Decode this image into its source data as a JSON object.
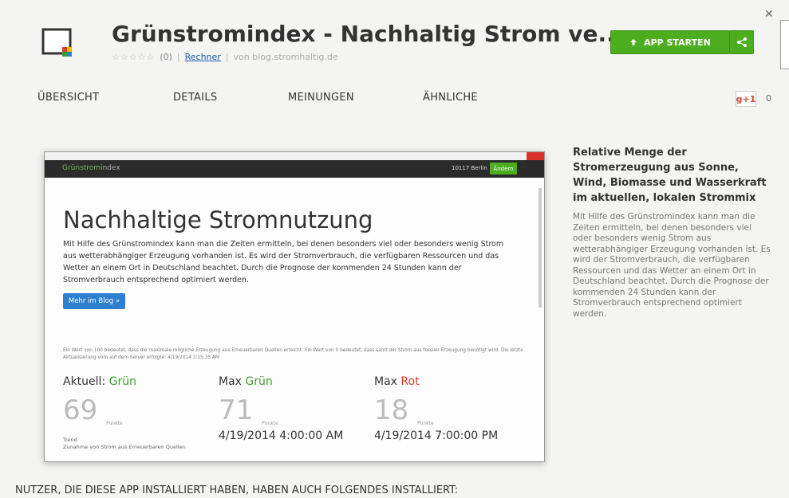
{
  "header": {
    "title": "Grünstromindex - Nachhaltig Strom ve...",
    "stars": "☆☆☆☆☆",
    "rating_count": "(0)",
    "category": "Rechner",
    "domain": "von blog.stromhaltig.de",
    "start_button": "APP STARTEN"
  },
  "tabs": [
    {
      "label": "ÜBERSICHT"
    },
    {
      "label": "DETAILS"
    },
    {
      "label": "MEINUNGEN"
    },
    {
      "label": "ÄHNLICHE"
    }
  ],
  "gplus": {
    "label": "g+1",
    "count": "0"
  },
  "preview": {
    "brand_green": "Grünstrom",
    "brand_gray": "index",
    "location": "10117 Berlin",
    "location_button": "Ändern",
    "heading": "Nachhaltige Stromnutzung",
    "intro": "Mit Hilfe des Grünstromindex kann man die Zeiten ermitteln, bei denen besonders viel oder besonders wenig Strom aus wetterabhängiger Erzeugung vorhanden ist. Es wird der Stromverbrauch, die verfügbaren Ressourcen und das Wetter an einem Ort in Deutschland beachtet. Durch die Prognose der kommenden 24 Stunden kann der Stromverbrauch entsprechend optimiert werden.",
    "blog_button": "Mehr im Blog »",
    "note": "Ein Wert von 100 bedeutet, dass die maximale mögliche Erzeugung aus Erneuerbaren Quellen erreicht. Ein Wert von 0 bedeutet, dass samt der Strom aus fossiler Erzeugung benötigt wird. Die letzte Aktualisierung vom auf dem Server erfolgte: 4/19/2014 3:15:35 AM",
    "current": {
      "label": "Aktuell: ",
      "state": "Grün",
      "value": "69",
      "unit": "Punkte"
    },
    "max_green": {
      "label": "Max ",
      "state": "Grün",
      "value": "71",
      "unit": "Punkte",
      "date": "4/19/2014 4:00:00 AM"
    },
    "max_red": {
      "label": "Max ",
      "state": "Rot",
      "value": "18",
      "unit": "Punkte",
      "date": "4/19/2014 7:00:00 PM"
    },
    "trend_label": "Trend",
    "trend_text": "Zunahme von Strom aus Erneuerbaren Quellen"
  },
  "description": {
    "title": "Relative Menge der Stromerzeugung aus Sonne, Wind, Biomasse und Wasserkraft im aktuellen, lokalen Strommix",
    "body": "Mit Hilfe des Grünstromindex kann man die Zeiten ermitteln, bei denen besonders viel oder besonders wenig Strom aus wetterabhängiger Erzeugung vorhanden ist. Es wird der Stromverbrauch, die verfügbaren Ressourcen und das Wetter an einem Ort in Deutschland beachtet. Durch die Prognose der kommenden 24 Stunden kann der Stromverbrauch entsprechend optimiert werden."
  },
  "bottom_heading": "NUTZER, DIE DIESE APP INSTALLIERT HABEN, HABEN AUCH FOLGENDES INSTALLIERT:",
  "colors": {
    "accent_green": "#4cae1f",
    "red": "#d9342b",
    "link_blue": "#1a56b4"
  }
}
